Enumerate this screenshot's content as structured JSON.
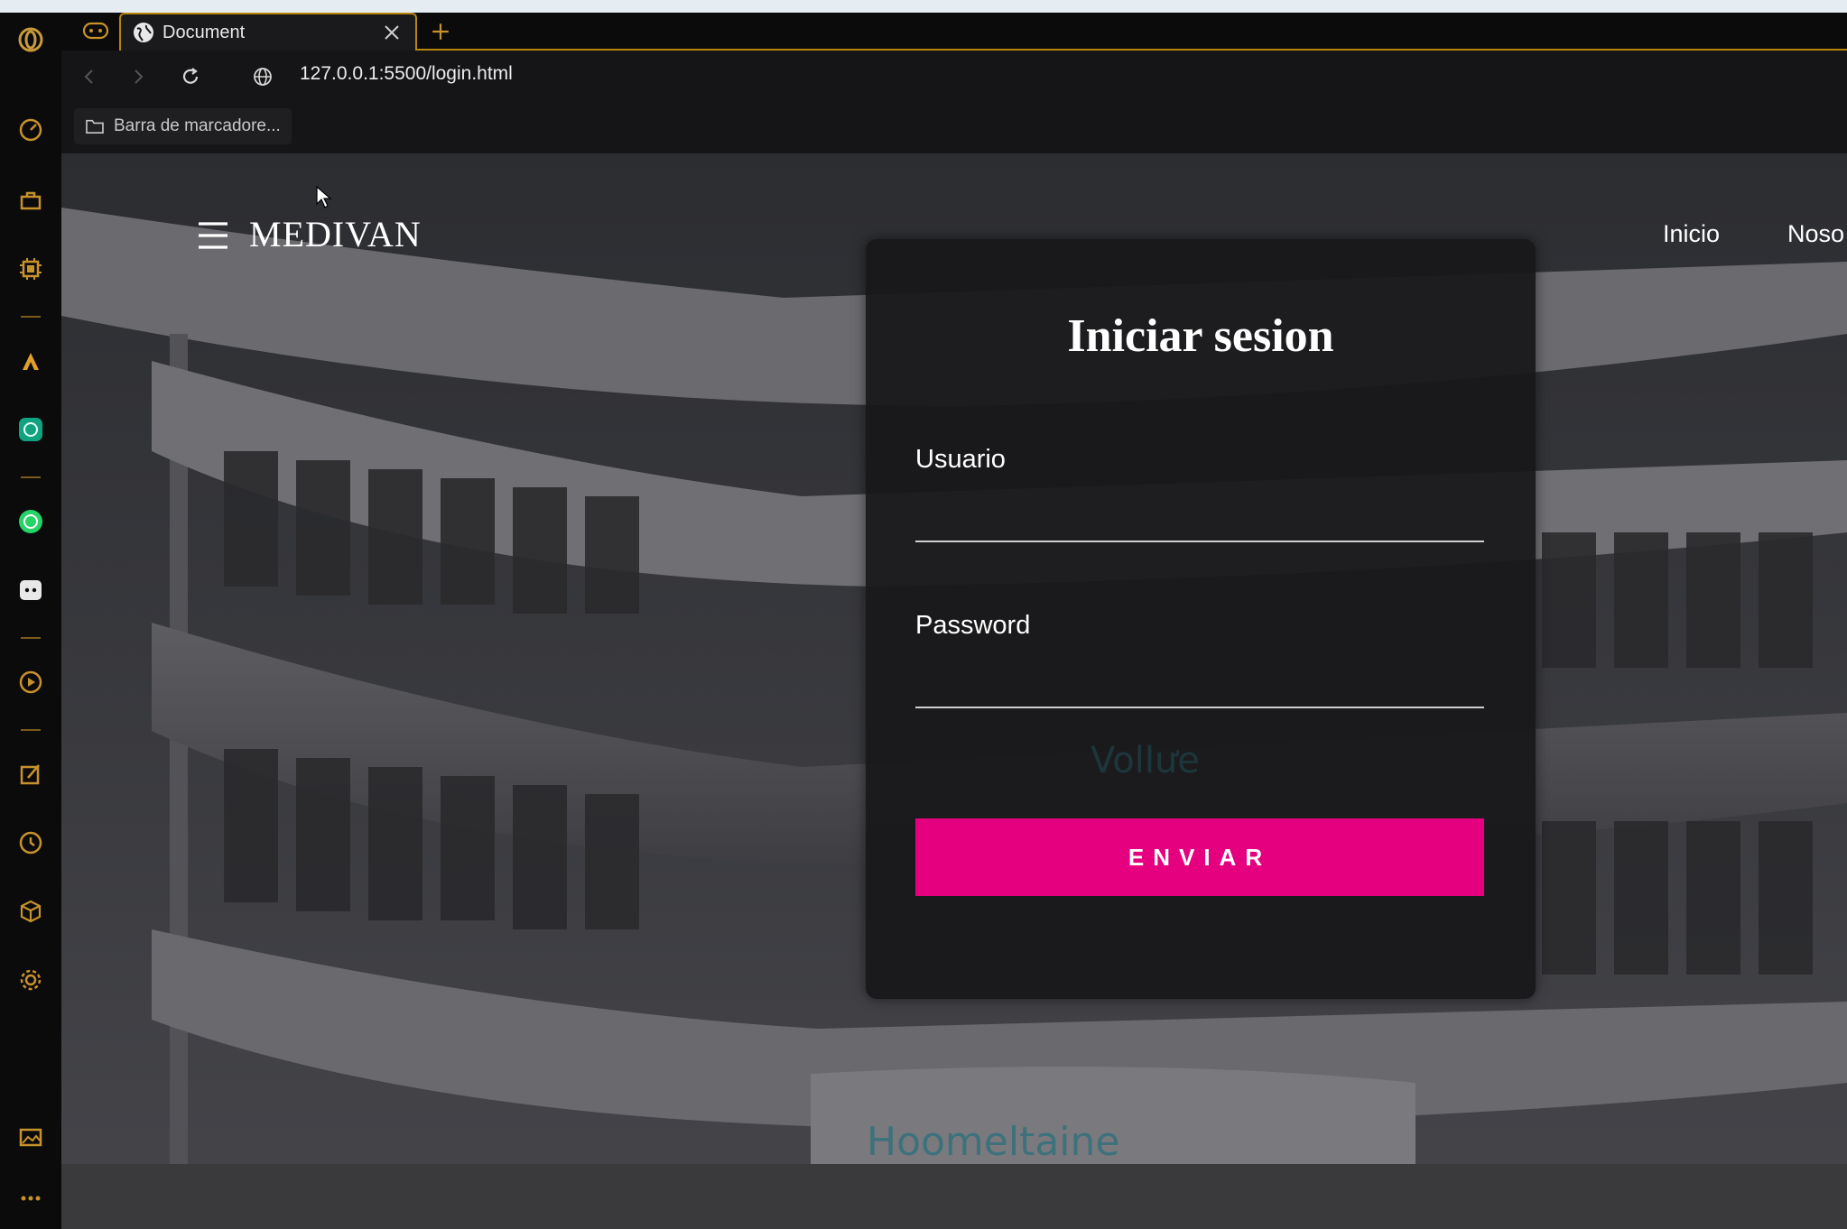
{
  "browser": {
    "tab": {
      "title": "Document"
    },
    "address": {
      "url": "127.0.0.1:5500/login.html"
    },
    "bookmarks": {
      "label": "Barra de marcadore..."
    }
  },
  "sidebar": {
    "icons": [
      "opera-logo-icon",
      "speed-dial-icon",
      "briefcase-icon",
      "cpu-icon",
      "aria-icon",
      "chatgpt-icon",
      "whatsapp-icon",
      "discord-icon",
      "player-icon",
      "pen-icon",
      "history-icon",
      "cube-icon",
      "settings-icon",
      "gallery-icon",
      "more-icon"
    ]
  },
  "site": {
    "brand": "MEDIVAN",
    "nav": [
      {
        "label": "Inicio"
      },
      {
        "label": "Noso"
      }
    ]
  },
  "login": {
    "title": "Iniciar sesion",
    "user_label": "Usuario",
    "user_value": "",
    "password_label": "Password",
    "password_value": "",
    "submit_label": "ENVIAR"
  },
  "background_text": {
    "sign_lower": "Hoomeltaine",
    "sign_upper": "Vollưe"
  },
  "colors": {
    "accent": "#e5007f",
    "browser_accent": "#b8860b",
    "card_bg": "#18181a"
  }
}
